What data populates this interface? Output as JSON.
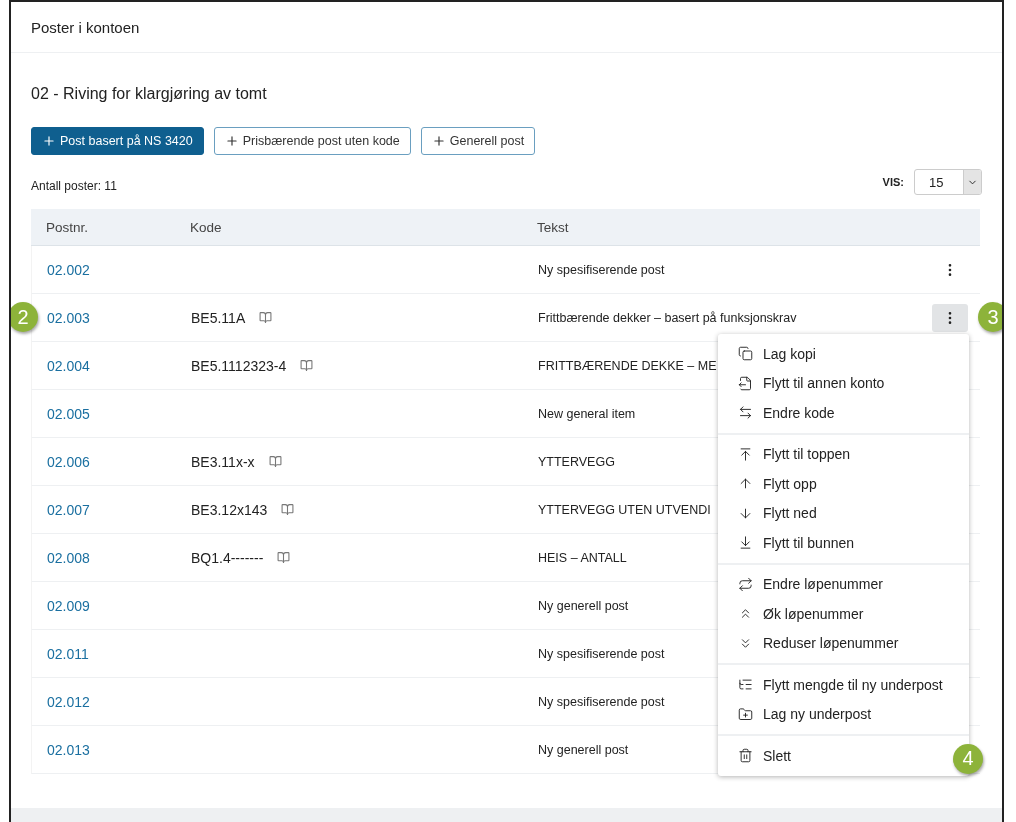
{
  "panel_title": "Poster i kontoen",
  "heading": "02 - Riving for klargjøring av tomt",
  "buttons": [
    {
      "label": "Post basert på NS 3420",
      "kind": "primary"
    },
    {
      "label": "Prisbærende post uten kode",
      "kind": "outline"
    },
    {
      "label": "Generell post",
      "kind": "outline"
    }
  ],
  "count": "Antall poster: 11",
  "page_size": {
    "label": "VIS:",
    "value": "15"
  },
  "table": {
    "columns": [
      "Postnr.",
      "Kode",
      "Tekst"
    ],
    "rows": [
      {
        "postnr": "02.002",
        "text": "Ny spesifiserende post",
        "menu_open": false
      },
      {
        "postnr": "02.003",
        "code": "BE5.11A",
        "text": "Frittbærende dekker – basert på funksjonskrav",
        "menu_open": true,
        "marker": "2",
        "actions_marker": "3"
      },
      {
        "postnr": "02.004",
        "code": "BE5.1112323-4",
        "text": "FRITTBÆRENDE DEKKE – ME"
      },
      {
        "postnr": "02.005",
        "text": "New general item"
      },
      {
        "postnr": "02.006",
        "code": "BE3.11x-x",
        "text": "YTTERVEGG"
      },
      {
        "postnr": "02.007",
        "code": "BE3.12x143",
        "text": "YTTERVEGG UTEN UTVENDI"
      },
      {
        "postnr": "02.008",
        "code": "BQ1.4-------",
        "text": "HEIS – ANTALL"
      },
      {
        "postnr": "02.009",
        "text": "Ny generell post"
      },
      {
        "postnr": "02.011",
        "text": "Ny spesifiserende post"
      },
      {
        "postnr": "02.012",
        "text": "Ny spesifiserende post"
      },
      {
        "postnr": "02.013",
        "text": "Ny generell post"
      }
    ]
  },
  "menu": {
    "marker": "4",
    "sections": [
      [
        {
          "label": "Lag kopi",
          "kind": "copy"
        },
        {
          "label": "Flytt til annen konto",
          "kind": "move-file"
        },
        {
          "label": "Endre kode",
          "kind": "swap"
        }
      ],
      [
        {
          "label": "Flytt til toppen",
          "kind": "top"
        },
        {
          "label": "Flytt opp",
          "kind": "up"
        },
        {
          "label": "Flytt ned",
          "kind": "down"
        },
        {
          "label": "Flytt til bunnen",
          "kind": "bottom"
        }
      ],
      [
        {
          "label": "Endre løpenummer",
          "kind": "swap-num"
        },
        {
          "label": "Øk løpenummer",
          "kind": "inc"
        },
        {
          "label": "Reduser løpenummer",
          "kind": "dec"
        }
      ],
      [
        {
          "label": "Flytt mengde til ny underpost",
          "kind": "tree"
        },
        {
          "label": "Lag ny underpost",
          "kind": "folder-plus"
        }
      ],
      [
        {
          "label": "Slett",
          "kind": "trash"
        }
      ]
    ]
  }
}
